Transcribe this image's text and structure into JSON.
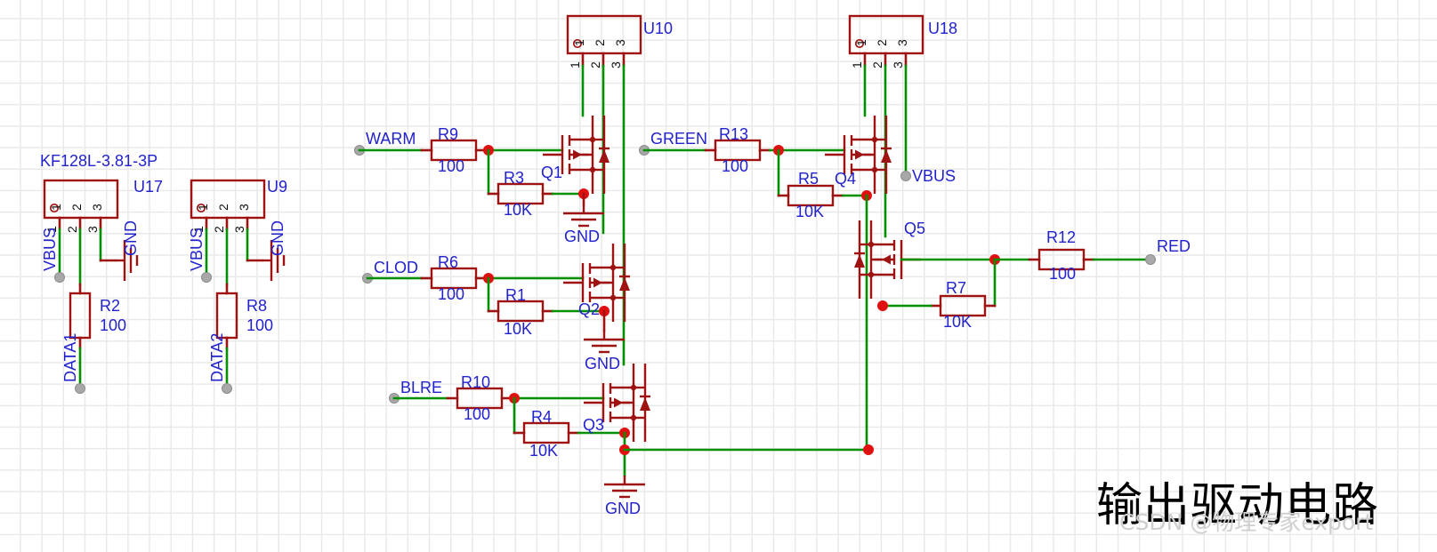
{
  "sheet": {
    "title_cn": "输出驱动电路",
    "watermark": "CSDN @物理专家export",
    "colors": {
      "component": "#9E1212",
      "wire": "#009000",
      "label": "#2222CC",
      "junction": "#E01010",
      "port": "#A8A8A8",
      "grid": "#E9E9E9",
      "background": "#FFFFFF"
    }
  },
  "annotations": {
    "connector_part_number": "KF128L-3.81-3P"
  },
  "connectors": [
    {
      "ref": "U17",
      "pin_numbers_inner": [
        "1",
        "2",
        "3"
      ],
      "pin_numbers_outer": [
        "1",
        "2",
        "3"
      ],
      "pin1_marker": "o"
    },
    {
      "ref": "U9",
      "pin_numbers_inner": [
        "1",
        "2",
        "3"
      ],
      "pin_numbers_outer": [
        "1",
        "2",
        "3"
      ],
      "pin1_marker": "o"
    },
    {
      "ref": "U10",
      "pin_numbers_inner": [
        "1",
        "2",
        "3"
      ],
      "pin_numbers_outer": [
        "1",
        "2",
        "3"
      ],
      "pin1_marker": "o"
    },
    {
      "ref": "U18",
      "pin_numbers_inner": [
        "1",
        "2",
        "3"
      ],
      "pin_numbers_outer": [
        "1",
        "2",
        "3"
      ],
      "pin1_marker": "o"
    }
  ],
  "resistors": [
    {
      "ref": "R2",
      "value": "100"
    },
    {
      "ref": "R8",
      "value": "100"
    },
    {
      "ref": "R9",
      "value": "100"
    },
    {
      "ref": "R3",
      "value": "10K"
    },
    {
      "ref": "R6",
      "value": "100"
    },
    {
      "ref": "R1",
      "value": "10K"
    },
    {
      "ref": "R10",
      "value": "100"
    },
    {
      "ref": "R4",
      "value": "10K"
    },
    {
      "ref": "R13",
      "value": "100"
    },
    {
      "ref": "R5",
      "value": "10K"
    },
    {
      "ref": "R7",
      "value": "10K"
    },
    {
      "ref": "R12",
      "value": "100"
    }
  ],
  "transistors": [
    {
      "ref": "Q1"
    },
    {
      "ref": "Q2"
    },
    {
      "ref": "Q3"
    },
    {
      "ref": "Q4"
    },
    {
      "ref": "Q5"
    }
  ],
  "net_ports": [
    {
      "name": "VBUS",
      "id": "vbus-u17"
    },
    {
      "name": "DATA1",
      "id": "data1"
    },
    {
      "name": "VBUS",
      "id": "vbus-u9"
    },
    {
      "name": "DATA2",
      "id": "data2"
    },
    {
      "name": "WARM",
      "id": "warm"
    },
    {
      "name": "CLOD",
      "id": "clod"
    },
    {
      "name": "BLRE",
      "id": "blre"
    },
    {
      "name": "GREEN",
      "id": "green"
    },
    {
      "name": "VBUS",
      "id": "vbus-u18"
    },
    {
      "name": "RED",
      "id": "red"
    }
  ],
  "ground_symbols": [
    {
      "id": "gnd-u17",
      "label": "GND",
      "orientation": "rotated"
    },
    {
      "id": "gnd-u9",
      "label": "GND",
      "orientation": "rotated"
    },
    {
      "id": "gnd-q1",
      "label": "GND",
      "orientation": "down"
    },
    {
      "id": "gnd-q2",
      "label": "GND",
      "orientation": "down"
    },
    {
      "id": "gnd-q3",
      "label": "GND",
      "orientation": "down"
    }
  ]
}
